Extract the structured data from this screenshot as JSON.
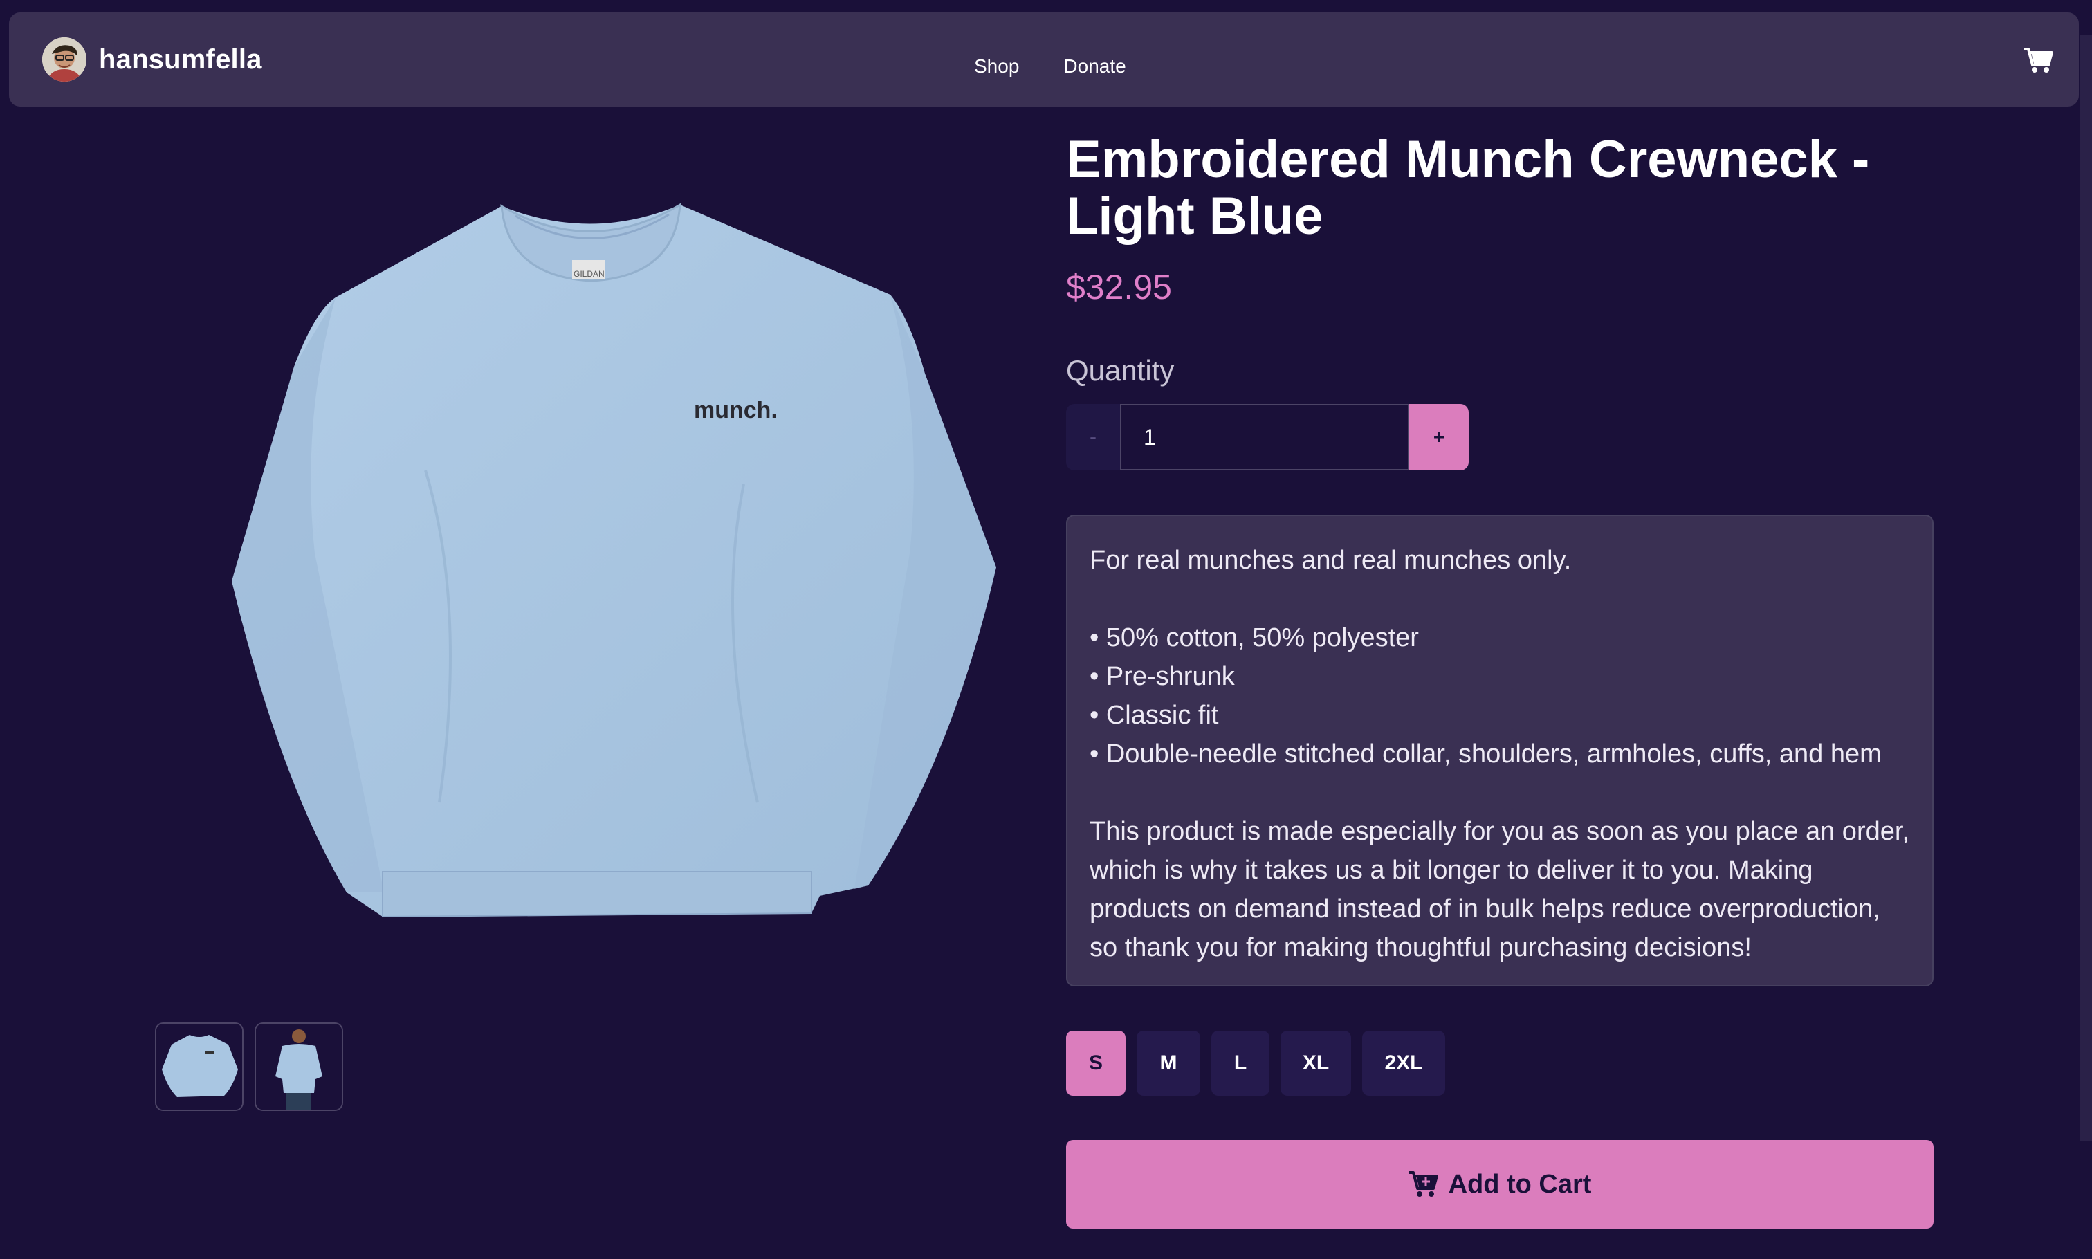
{
  "navbar": {
    "brand": "hansumfella",
    "links": [
      "Shop",
      "Donate"
    ],
    "icons": {
      "avatar": "avatar-image",
      "cart": "shopping-cart-icon"
    }
  },
  "product": {
    "title": "Embroidered Munch Crewneck - Light Blue",
    "price": "$32.95",
    "image_embroidery": "munch.",
    "image_tag": "GILDAN",
    "thumbnails": [
      "sweater-front",
      "model-wearing-sweater"
    ]
  },
  "quantity": {
    "label": "Quantity",
    "minus": "-",
    "value": "1",
    "plus": "+"
  },
  "description": {
    "lines": [
      "For real munches and real munches only.",
      "",
      "• 50% cotton, 50% polyester",
      "• Pre-shrunk",
      "• Classic fit",
      "• Double-needle stitched collar, shoulders, armholes, cuffs, and hem",
      "",
      "This product is made especially for you as soon as you place an order, which is why it takes us a bit longer to deliver it to you. Making products on demand instead of in bulk helps reduce overproduction, so thank you for making thoughtful purchasing decisions!"
    ]
  },
  "sizes": {
    "options": [
      "S",
      "M",
      "L",
      "XL",
      "2XL"
    ],
    "selected": "S"
  },
  "add_to_cart": {
    "label": "Add to Cart",
    "icon": "cart-plus-icon"
  },
  "colors": {
    "background": "#1a1039",
    "navbar": "#3a3053",
    "accent": "#db7dbd",
    "price": "#e07fca",
    "sweater": "#a9c6e2"
  }
}
